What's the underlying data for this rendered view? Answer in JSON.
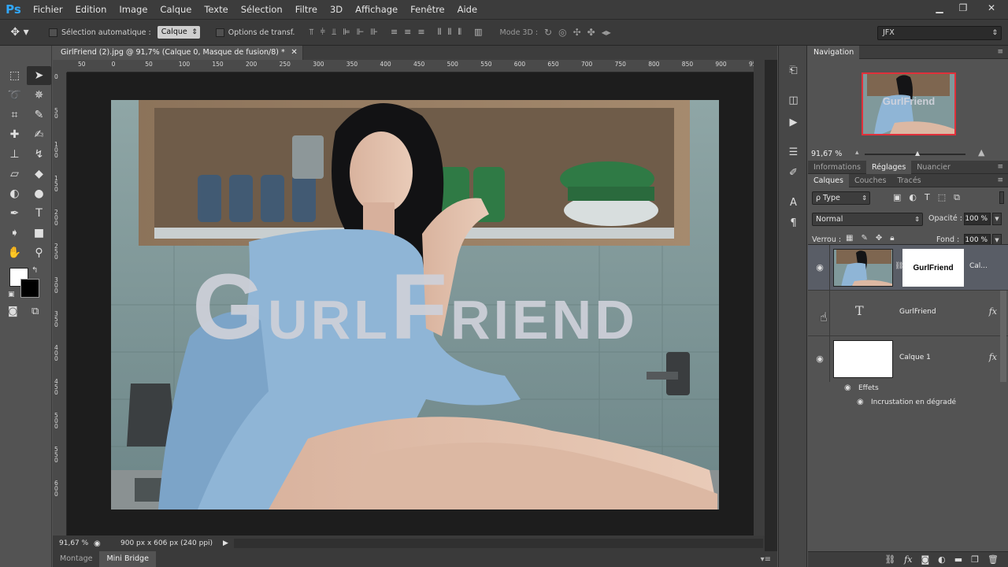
{
  "app": {
    "logo": "Ps"
  },
  "menu": [
    "Fichier",
    "Edition",
    "Image",
    "Calque",
    "Texte",
    "Sélection",
    "Filtre",
    "3D",
    "Affichage",
    "Fenêtre",
    "Aide"
  ],
  "window_controls": {
    "minimize": "▁",
    "restore": "❐",
    "close": "✕"
  },
  "options_bar": {
    "tool_icon": "move-tool-icon",
    "auto_select_label": "Sélection automatique :",
    "auto_select_value": "Calque",
    "transform_label": "Options de transf.",
    "mode3d_label": "Mode 3D :",
    "workspace": "JFX"
  },
  "document": {
    "tab_title": "GirlFriend (2).jpg @ 91,7% (Calque 0, Masque de fusion/8) *",
    "close_icon": "✕",
    "ruler_h_ticks": [
      "50",
      "0",
      "50",
      "100",
      "150",
      "200",
      "250",
      "300",
      "350",
      "400",
      "450",
      "500",
      "550",
      "600",
      "650",
      "700",
      "750",
      "800",
      "850",
      "900",
      "95"
    ],
    "ruler_v_ticks": [
      "0",
      "5\n0",
      "1\n0\n0",
      "1\n5\n0",
      "2\n0\n0",
      "2\n5\n0",
      "3\n0\n0",
      "3\n5\n0",
      "4\n0\n0",
      "4\n5\n0",
      "5\n0\n0",
      "5\n5\n0",
      "6\n0\n0"
    ],
    "overlay_text": {
      "g": "G",
      "url": "URL",
      "f": "F",
      "riend": "RIEND"
    }
  },
  "status_bar": {
    "zoom": "91,67 %",
    "doc_info": "900 px x 606 px (240 ppi)",
    "arrow": "▶"
  },
  "bottom_tabs": [
    "Montage",
    "Mini Bridge"
  ],
  "navigation": {
    "tab": "Navigation",
    "thumb_text": "GurlFriend",
    "zoom": "91,67 %"
  },
  "panel_tabs_info": [
    "Informations",
    "Réglages",
    "Nuancier"
  ],
  "panel_tabs_layers": [
    "Calques",
    "Couches",
    "Tracés"
  ],
  "layers_options": {
    "filter_type": "ρ Type",
    "blend_mode": "Normal",
    "opacity_label": "Opacité :",
    "opacity_value": "100 %",
    "lock_label": "Verrou :",
    "fill_label": "Fond :",
    "fill_value": "100 %"
  },
  "layers": [
    {
      "name": "Cal...",
      "mask_text": "GurlFriend",
      "type": "image-mask",
      "selected": true
    },
    {
      "name": "GurlFriend",
      "type": "text",
      "fx": "fx"
    },
    {
      "name": "Calque 1",
      "type": "fill",
      "fx": "fx"
    }
  ],
  "effects": {
    "label": "Effets",
    "items": [
      "Incrustation en dégradé"
    ]
  },
  "colors": {
    "accent_blue": "#31a8ff",
    "nav_frame": "#e0303a",
    "selected_layer": "#595d66"
  }
}
